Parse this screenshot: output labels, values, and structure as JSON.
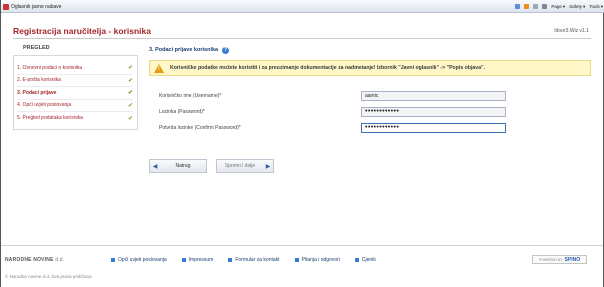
{
  "browser": {
    "tab_title": "Oglasnik javne nabave",
    "tools": [
      "Page",
      "Safety",
      "Tools"
    ]
  },
  "header": {
    "title": "Registracija naručitelja - korisnika",
    "version": "Idoor3.Wiz v1.1"
  },
  "sidebar": {
    "title": "PREGLED",
    "items": [
      {
        "label": "1. Osnovni podaci o korisniku"
      },
      {
        "label": "2. E-pošta korisnika"
      },
      {
        "label": "3. Podaci prijave"
      },
      {
        "label": "4. Opći uvjeti poslovanja"
      },
      {
        "label": "5. Pregled podataka korisnika"
      }
    ],
    "check_icon": "✔"
  },
  "section": {
    "title": "3. Podaci prijave korisnika",
    "help_icon": "?"
  },
  "warning": {
    "text": "Korisničke podatke možete koristiti i za preuzimanje dokumentacije za nadmetanje! Izbornik \"Javni oglasnik\" -> \"Popis objava\"."
  },
  "form": {
    "username_label": "Korisničko ime (Username)*",
    "username_value": "aamic",
    "password_label": "Lozinka (Password)*",
    "password_value": "••••••••••••",
    "confirm_label": "Potvrda lozinke (Confirm Password)*",
    "confirm_value": "••••••••••••"
  },
  "buttons": {
    "back_label": "Natrag",
    "next_label": "Spremi i dalje",
    "back_arrow": "◀",
    "next_arrow": "▶"
  },
  "footer": {
    "brand": "NARODNE NOVINE",
    "brand_suffix": "d.d.",
    "links": [
      "Opći uvjeti poslovanja",
      "Impressum",
      "Formular za kontakt",
      "Pitanja i odgovori",
      "Cjenik"
    ],
    "powered_prefix": "POWERED BY",
    "powered_brand": "SPINO",
    "copyright": "© Narodne novine d.d. Sva prava pridržana"
  }
}
